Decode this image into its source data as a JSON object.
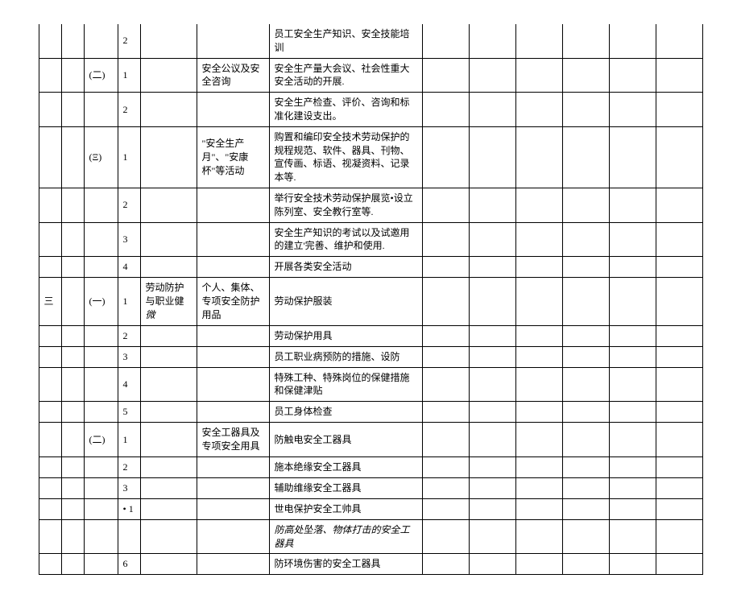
{
  "rows": [
    {
      "c": "",
      "d": "2",
      "e": "",
      "f": "",
      "g": "员工安全生产知识、安全技能培训",
      "topOpen": true
    },
    {
      "c": "(二)",
      "d": "1",
      "e": "",
      "f": "安全公议及安全咨询",
      "g": "安全生产量大会议、社会性重大安全活动的开展."
    },
    {
      "c": "",
      "d": "2",
      "e": "",
      "f": "",
      "g": "安全生产检查、评价、咨询和标准化建设支出。"
    },
    {
      "c": "(Ξ)",
      "d": "1",
      "e": "",
      "f": "\"安全生产月\"、\"安康杯\"等活动",
      "g": "购置和编印安全技术劳动保护的规程规范、软件、器具、刊物、宣传画、标语、视凝资料、记录\n本等."
    },
    {
      "c": "",
      "d": "2",
      "e": "",
      "f": "",
      "g": "举行安全技术劳动保护展览•设立陈列室、安全教行室等."
    },
    {
      "c": "",
      "d": "3",
      "e": "",
      "f": "",
      "g": "安全生产知识的考试以及试邀用的建立'完善、维护和使用."
    },
    {
      "c": "",
      "d": "4",
      "e": "",
      "f": "",
      "g": "开展各类安全活动"
    },
    {
      "a": "三",
      "c": "(一)",
      "d": "1",
      "e": "劳动防护与职业健\n微",
      "f": "个人、集体、专项安全防护用品",
      "g": "劳动保护服装"
    },
    {
      "c": "",
      "d": "2",
      "e": "",
      "f": "",
      "g": "劳动保护用具"
    },
    {
      "c": "",
      "d": "3",
      "e": "",
      "f": "",
      "g": "员工职业病预防的措施、设防"
    },
    {
      "c": "",
      "d": "4",
      "e": "",
      "f": "",
      "g": "特殊工种、特殊岗位的保健措施和保健津贴"
    },
    {
      "c": "",
      "d": "5",
      "e": "",
      "f": "",
      "g": "员工身体检查"
    },
    {
      "c": "(二)",
      "d": "1",
      "e": "",
      "f": "安全工器具及专项安全用具",
      "g": "防触电安全工器具"
    },
    {
      "c": "",
      "d": "2",
      "e": "",
      "f": "",
      "g": "施本绝缘安全工器具"
    },
    {
      "c": "",
      "d": "3",
      "e": "",
      "f": "",
      "g": "辅助维缘安全工器具"
    },
    {
      "c": "",
      "d": "• 1",
      "e": "",
      "f": "",
      "g": "世电保护安全工帅具"
    },
    {
      "c": "",
      "d": "",
      "e": "",
      "f": "",
      "g": "防高处坠落、物体打击的安全工器具",
      "italicG": true
    },
    {
      "c": "",
      "d": "6",
      "e": "",
      "f": "",
      "g": "防环境伤害的安全工器具"
    }
  ]
}
